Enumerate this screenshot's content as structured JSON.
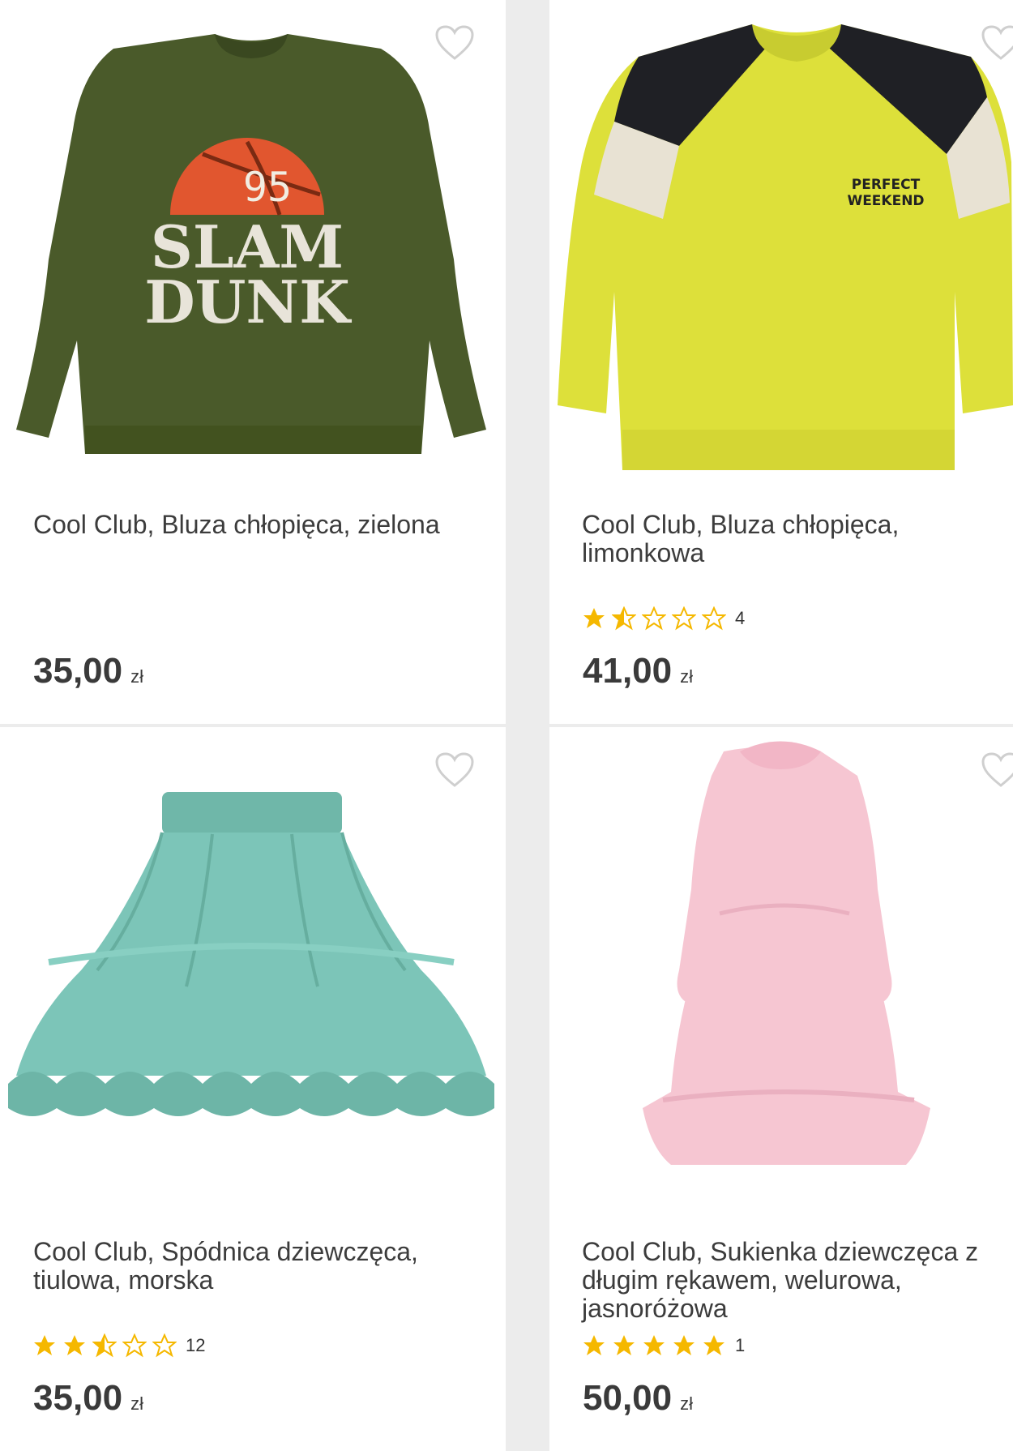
{
  "products": [
    {
      "title": "Cool Club, Bluza chłopięca, zielona",
      "price": "35,00",
      "currency": "zł",
      "rating": null,
      "image": {
        "garment": "sweatshirt",
        "color": "#4a5a2a",
        "print_line1": "95",
        "print_line2": "SLAM",
        "print_line3": "DUNK"
      }
    },
    {
      "title": "Cool Club, Bluza chłopięca, limonkowa",
      "price": "41,00",
      "currency": "zł",
      "rating": {
        "stars": 1.5,
        "count": "4"
      },
      "image": {
        "garment": "sweatshirt",
        "color": "#dde03a",
        "print_line1": "PERFECT",
        "print_line2": "WEEKEND"
      }
    },
    {
      "title": "Cool Club, Spódnica dziewczęca, tiulowa, morska",
      "price": "35,00",
      "currency": "zł",
      "rating": {
        "stars": 2.5,
        "count": "12"
      },
      "image": {
        "garment": "tulle-skirt",
        "color": "#7cc5b8"
      }
    },
    {
      "title": "Cool Club, Sukienka dziewczęca z długim rękawem, welurowa, jasnoróżowa",
      "price": "50,00",
      "currency": "zł",
      "rating": {
        "stars": 5,
        "count": "1"
      },
      "image": {
        "garment": "dress",
        "color": "#f6c6d2"
      }
    }
  ],
  "colors": {
    "star": "#f5b800",
    "heart": "#cfcfcf",
    "page_bg": "#ececec",
    "card_bg": "#ffffff"
  }
}
